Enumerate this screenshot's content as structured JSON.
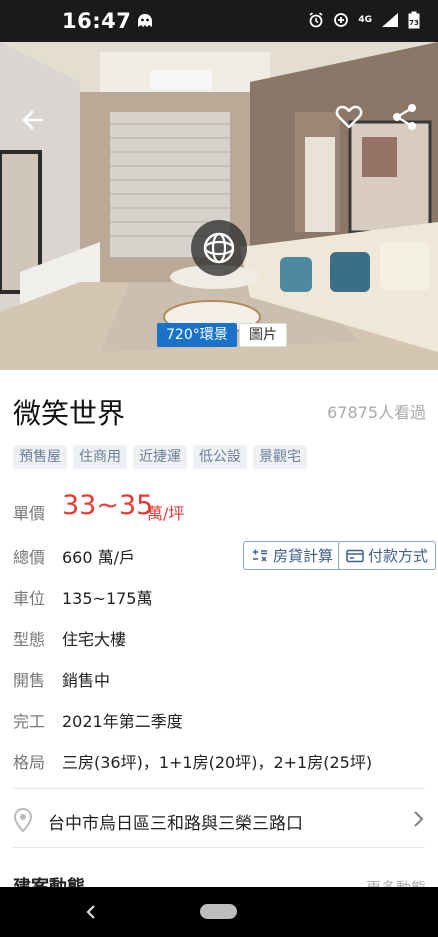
{
  "status_bar": {
    "time": "16:47",
    "network": "4G",
    "battery": "73",
    "icons": [
      "ghost-icon",
      "alarm-icon",
      "data-saver-icon",
      "signal-icon",
      "battery-icon"
    ]
  },
  "hero": {
    "view_720_label": "720°環景",
    "photo_label": "圖片",
    "icons": [
      "back-arrow-icon",
      "heart-icon",
      "share-icon",
      "vr-360-icon"
    ]
  },
  "listing": {
    "title": "微笑世界",
    "views": "67875人看過",
    "tags": [
      "預售屋",
      "住商用",
      "近捷運",
      "低公設",
      "景觀宅"
    ],
    "unit_price": {
      "label": "單價",
      "value": "33~35",
      "unit": "萬/坪"
    },
    "total_price": {
      "label": "總價",
      "value": "660 萬/戶"
    },
    "parking": {
      "label": "車位",
      "value": "135~175萬"
    },
    "type": {
      "label": "型態",
      "value": "住宅大樓"
    },
    "sales": {
      "label": "開售",
      "value": "銷售中"
    },
    "completion": {
      "label": "完工",
      "value": "2021年第二季度"
    },
    "layout": {
      "label": "格局",
      "value": "三房(36坪)，1+1房(20坪)，2+1房(25坪)"
    },
    "address": "台中市烏日區三和路與三榮三路口",
    "next_section_left": "建案動態",
    "next_section_right": "更多動態"
  },
  "actions": {
    "loan_calc": "房貸計算",
    "payment": "付款方式"
  },
  "colors": {
    "accent_blue": "#1a73c9",
    "price_red": "#e53935",
    "tag_text": "#6b7f99",
    "tag_bg": "#eef2f7"
  }
}
